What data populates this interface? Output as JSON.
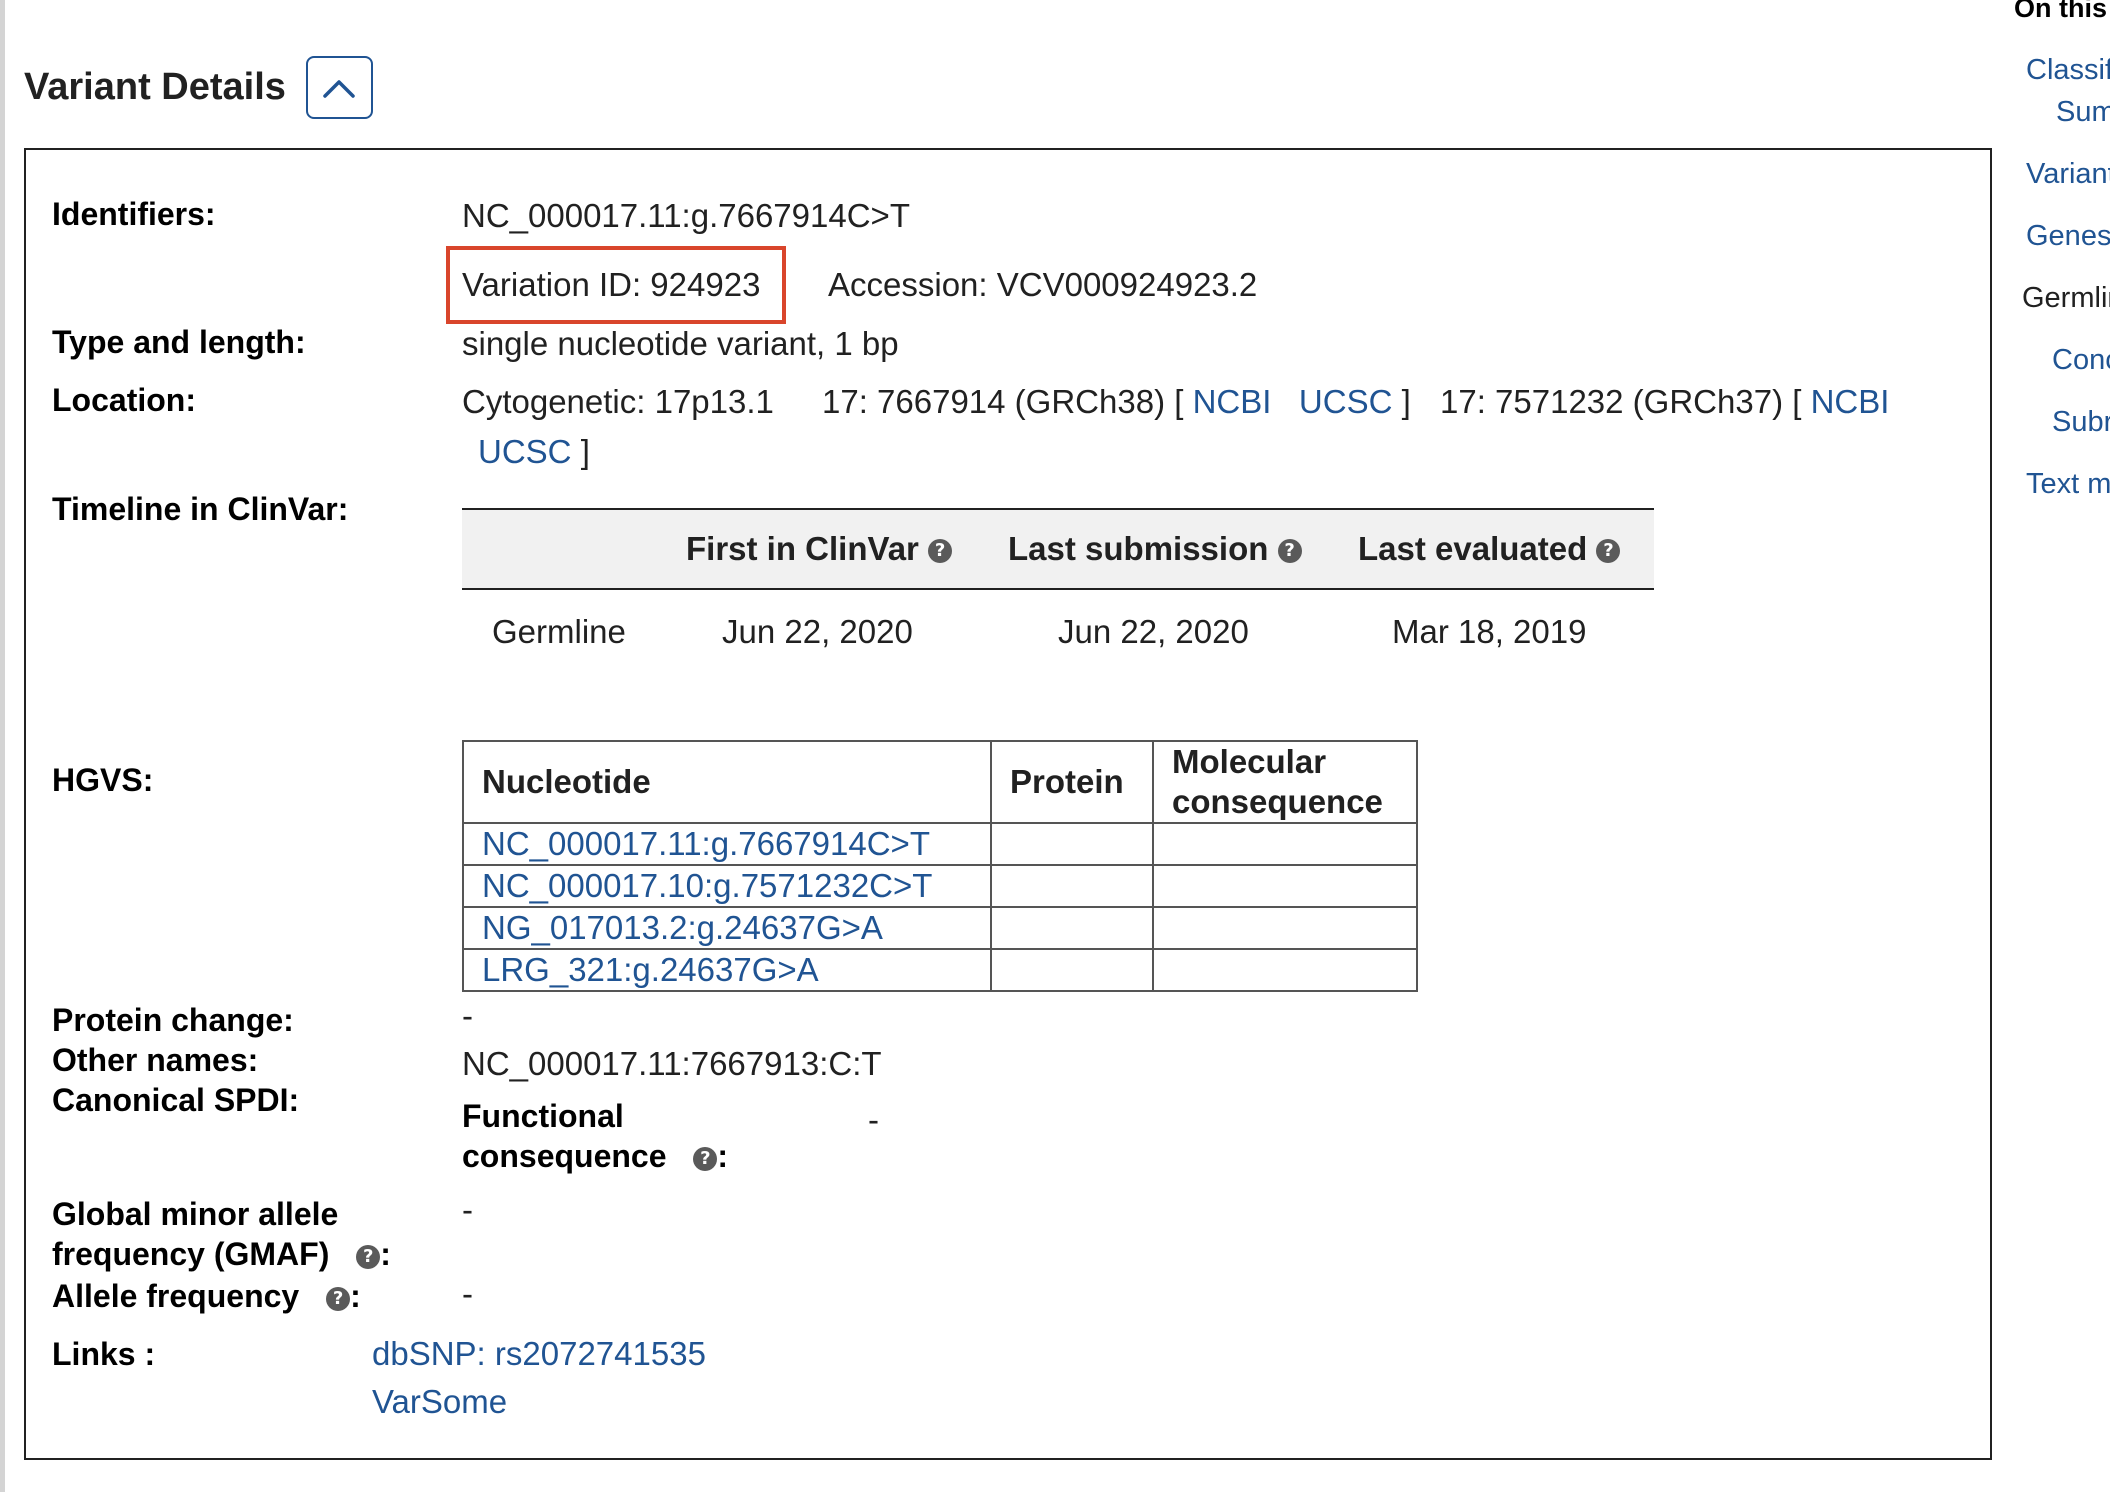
{
  "section": {
    "title": "Variant Details"
  },
  "identifiers": {
    "label": "Identifiers:",
    "hgvs_id": "NC_000017.11:g.7667914C>T",
    "variation_id": "Variation ID: 924923",
    "accession": "Accession: VCV000924923.2"
  },
  "type_length": {
    "label": "Type and length:",
    "value": "single nucleotide variant, 1 bp"
  },
  "location": {
    "label": "Location:",
    "cytogenetic": "Cytogenetic: 17p13.1",
    "grch38": "17: 7667914 (GRCh38) [",
    "grch37": "17: 7571232 (GRCh37) [",
    "ncbi": "NCBI",
    "ucsc": "UCSC",
    "close_bracket": "]"
  },
  "timeline": {
    "label": "Timeline in ClinVar:",
    "headers": [
      "First in ClinVar",
      "Last submission",
      "Last evaluated"
    ],
    "row_label": "Germline",
    "values": [
      "Jun 22, 2020",
      "Jun 22, 2020",
      "Mar 18, 2019"
    ]
  },
  "hgvs": {
    "label": "HGVS:",
    "headers": [
      "Nucleotide",
      "Protein",
      "Molecular consequence"
    ],
    "rows": [
      "NC_000017.11:g.7667914C>T",
      "NC_000017.10:g.7571232C>T",
      "NG_017013.2:g.24637G>A",
      "LRG_321:g.24637G>A"
    ]
  },
  "protein_change": {
    "label": "Protein change:",
    "value": "-"
  },
  "other_names": {
    "label": "Other names:"
  },
  "canonical_spdi": {
    "label": "Canonical SPDI:",
    "value": "NC_000017.11:7667913:C:T"
  },
  "functional_consequence": {
    "label_line1": "Functional",
    "label_line2": "consequence",
    "colon": ":",
    "value": "-"
  },
  "gmaf": {
    "label_line1": "Global minor allele",
    "label_line2": "frequency (GMAF)",
    "colon": ":",
    "value": "-"
  },
  "allele_frequency": {
    "label": "Allele frequency",
    "colon": ":",
    "value": "-"
  },
  "links": {
    "label": "Links :",
    "dbsnp": "dbSNP: rs2072741535",
    "varsome": "VarSome"
  },
  "right_nav": {
    "heading": "On this",
    "items": [
      "Classif",
      "Sum",
      "Variant",
      "Genes",
      "Germlin",
      "Conc",
      "Subr",
      "Text m"
    ]
  },
  "colors": {
    "link": "#205493",
    "highlight": "#d9452b"
  },
  "icons": [
    "chevron-up-icon",
    "help-icon"
  ]
}
